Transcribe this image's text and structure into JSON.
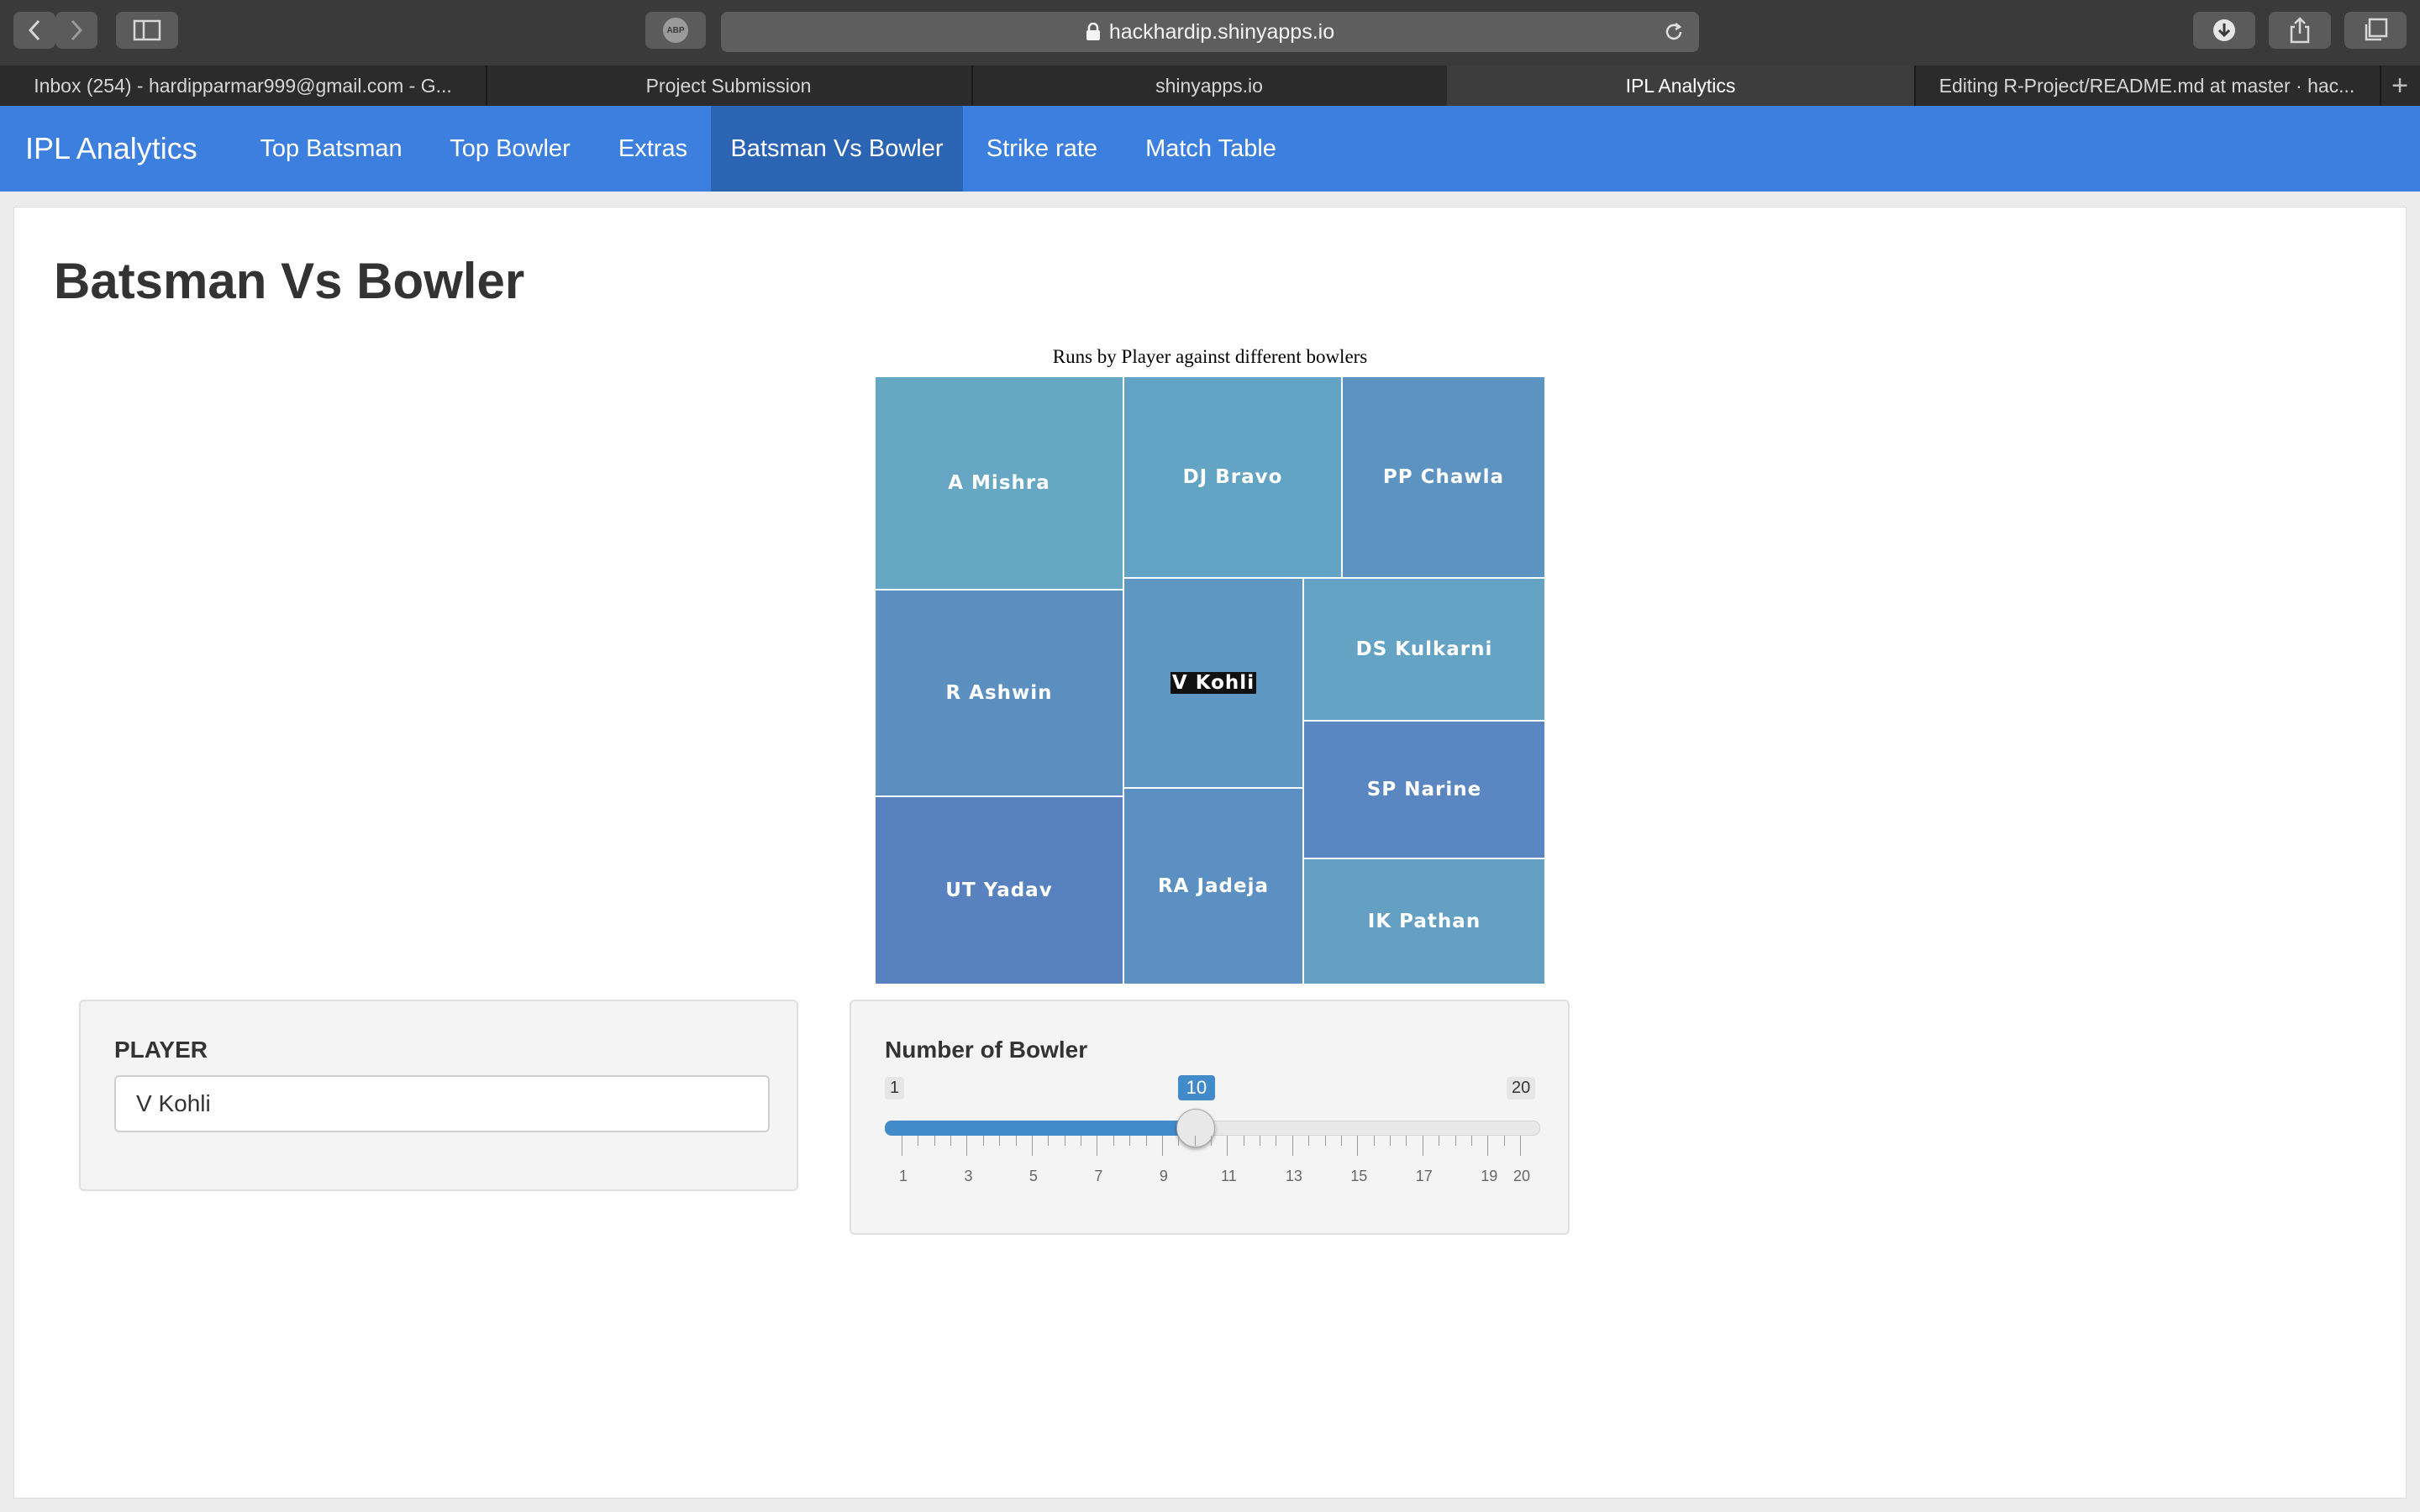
{
  "browser": {
    "url": "hackhardip.shinyapps.io",
    "adblock_label": "ABP",
    "tabs": [
      {
        "label": "Inbox (254) - hardipparmar999@gmail.com - G...",
        "active": false
      },
      {
        "label": "Project Submission",
        "active": false
      },
      {
        "label": "shinyapps.io",
        "active": false
      },
      {
        "label": "IPL Analytics",
        "active": true
      },
      {
        "label": "Editing R-Project/README.md at master · hac...",
        "active": false
      }
    ],
    "new_tab_label": "+"
  },
  "navbar": {
    "brand": "IPL Analytics",
    "items": [
      {
        "label": "Top Batsman",
        "active": false
      },
      {
        "label": "Top Bowler",
        "active": false
      },
      {
        "label": "Extras",
        "active": false
      },
      {
        "label": "Batsman Vs Bowler",
        "active": true
      },
      {
        "label": "Strike rate",
        "active": false
      },
      {
        "label": "Match Table",
        "active": false
      }
    ]
  },
  "page": {
    "title": "Batsman Vs Bowler"
  },
  "chart_data": {
    "type": "treemap",
    "title": "Runs by Player against different bowlers",
    "root_label": "V Kohli",
    "cells": [
      {
        "label": "A Mishra",
        "color": "#66a8c3"
      },
      {
        "label": "DJ Bravo",
        "color": "#63a3c4"
      },
      {
        "label": "PP Chawla",
        "color": "#5d93c1"
      },
      {
        "label": "R Ashwin",
        "color": "#5b8fc0"
      },
      {
        "label": "DS Kulkarni",
        "color": "#64a3c3"
      },
      {
        "label": "SP Narine",
        "color": "#5a87c2"
      },
      {
        "label": "UT Yadav",
        "color": "#5881c0"
      },
      {
        "label": "RA Jadeja",
        "color": "#5c8fc2"
      },
      {
        "label": "IK Pathan",
        "color": "#64a0c3"
      }
    ]
  },
  "player_panel": {
    "label": "PLAYER",
    "value": "V Kohli"
  },
  "bowler_panel": {
    "label": "Number of Bowler",
    "min": 1,
    "max": 20,
    "value": 10,
    "min_label": "1",
    "max_label": "20",
    "value_label": "10",
    "tick_labels": [
      "1",
      "3",
      "5",
      "7",
      "9",
      "11",
      "13",
      "15",
      "17",
      "19",
      "20"
    ]
  },
  "colors": {
    "navbar": "#3c7fde",
    "navbar_active": "#2a64b3",
    "slider_accent": "#428bca"
  }
}
